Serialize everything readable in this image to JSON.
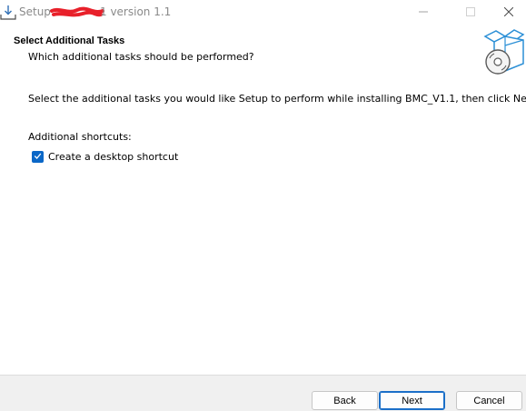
{
  "window": {
    "title_prefix": "Setup",
    "title_suffix": "1 version 1.1"
  },
  "header": {
    "heading": "Select Additional Tasks",
    "subheading": "Which additional tasks should be performed?"
  },
  "body": {
    "instruction": "Select the additional tasks you would like Setup to perform while installing BMC_V1.1, then click Next.",
    "group_label": "Additional shortcuts:",
    "tasks": [
      {
        "label": "Create a desktop shortcut",
        "checked": true
      }
    ]
  },
  "footer": {
    "back_label": "Back",
    "next_label": "Next",
    "cancel_label": "Cancel"
  },
  "icons": {
    "app": "installer-download-icon",
    "header": "software-box-disc-icon",
    "checkbox": "checkmark-icon"
  },
  "colors": {
    "accent": "#0a67c7",
    "title_text": "#8a8a8a",
    "redaction": "#e8202a"
  }
}
